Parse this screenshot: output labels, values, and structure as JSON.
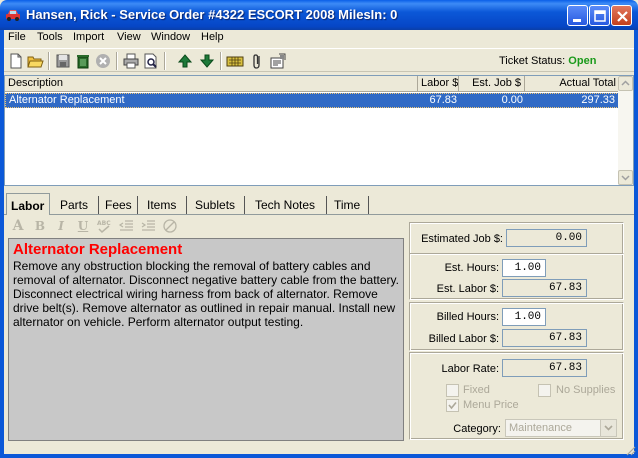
{
  "window": {
    "title": "Hansen, Rick - Service Order #4322   ESCORT 2008   MilesIn: 0",
    "icon": "car-icon"
  },
  "menu": [
    "File",
    "Tools",
    "Import",
    "View",
    "Window",
    "Help"
  ],
  "toolbar": {
    "icons": [
      "new-icon",
      "open-icon",
      "save-icon",
      "delete-icon",
      "cancel-icon",
      "print-icon",
      "print-preview-icon",
      "move-up-icon",
      "move-down-icon",
      "calculator-icon",
      "attach-icon",
      "properties-icon"
    ],
    "status_label": "Ticket Status:",
    "status_value": "Open",
    "status_color": "#1a9a1a"
  },
  "joblist": {
    "columns": [
      "Description",
      "Labor $",
      "Est. Job $",
      "Actual Total"
    ],
    "rows": [
      {
        "description": "Alternator Replacement",
        "labor": "67.83",
        "est_job": "0.00",
        "actual_total": "297.33"
      }
    ]
  },
  "tabs": [
    {
      "label": "Labor",
      "active": true
    },
    {
      "label": "Parts",
      "active": false
    },
    {
      "label": "Fees",
      "active": false
    },
    {
      "label": "Items",
      "active": false
    },
    {
      "label": "Sublets",
      "active": false
    },
    {
      "label": "Tech Notes",
      "active": false
    },
    {
      "label": "Time",
      "active": false
    }
  ],
  "format_tools": [
    "font-color-icon",
    "bold-icon",
    "italic-icon",
    "underline-icon",
    "spellcheck-icon",
    "outdent-icon",
    "indent-icon",
    "clear-icon"
  ],
  "notes": {
    "title": "Alternator Replacement",
    "body": "Remove any obstruction blocking the removal of battery cables and removal of alternator.  Disconnect negative battery cable from the battery.  Disconnect electrical wiring harness from back of alternator.  Remove drive belt(s).  Remove alternator as outlined in repair manual. Install new alternator on vehicle.  Perform alternator output testing.",
    "title_color": "#ff0000"
  },
  "labor": {
    "est_job_label": "Estimated Job $:",
    "est_job_value": "0.00",
    "est_hours_label": "Est. Hours:",
    "est_hours_value": "1.00",
    "est_labor_label": "Est. Labor $:",
    "est_labor_value": "67.83",
    "billed_hours_label": "Billed Hours:",
    "billed_hours_value": "1.00",
    "billed_labor_label": "Billed Labor $:",
    "billed_labor_value": "67.83",
    "labor_rate_label": "Labor Rate:",
    "labor_rate_value": "67.83",
    "fixed_label": "Fixed",
    "no_supplies_label": "No Supplies",
    "menu_price_label": "Menu Price",
    "category_label": "Category:",
    "category_value": "Maintenance"
  }
}
